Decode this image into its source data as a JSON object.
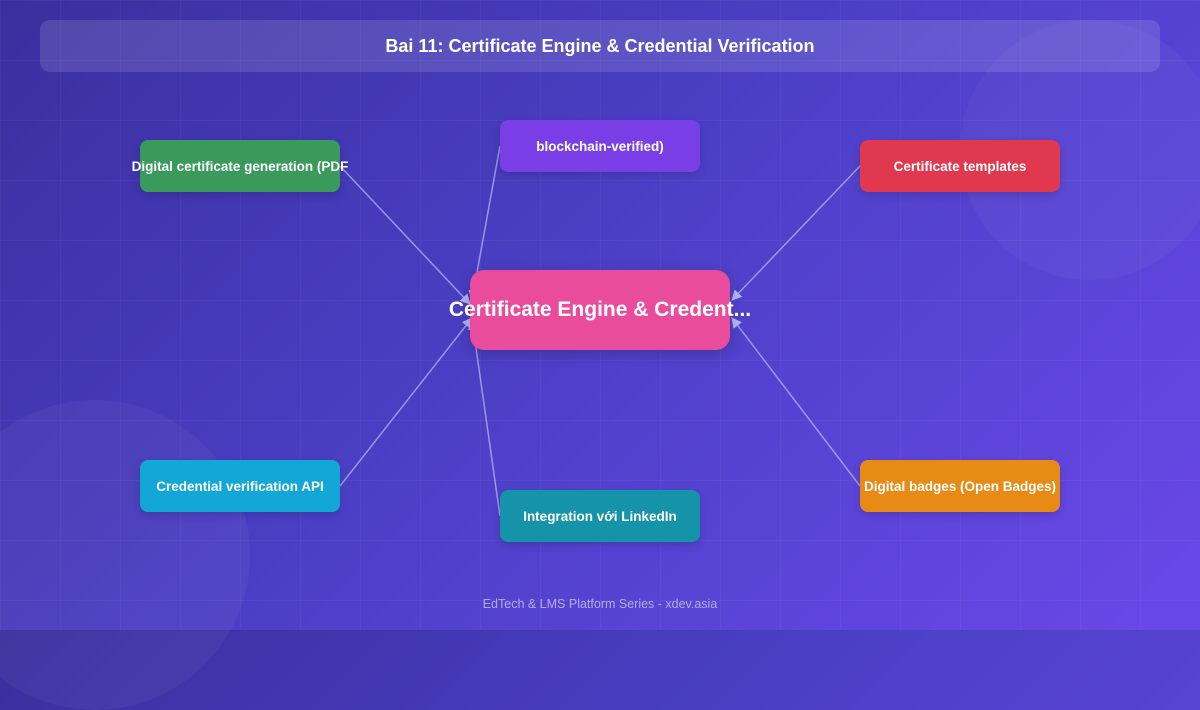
{
  "title": "Bai 11: Certificate Engine & Credential Verification",
  "center": {
    "label": "Certificate Engine & Credent..."
  },
  "nodes": [
    {
      "id": "n1",
      "label": "Digital certificate generation (PDF",
      "color": "#3a9a5b"
    },
    {
      "id": "n2",
      "label": "blockchain-verified)",
      "color": "#7a3ee6"
    },
    {
      "id": "n3",
      "label": "Certificate templates",
      "color": "#e0394f"
    },
    {
      "id": "n4",
      "label": "Credential verification API",
      "color": "#12a7d6"
    },
    {
      "id": "n5",
      "label": "Integration với LinkedIn",
      "color": "#1593a8"
    },
    {
      "id": "n6",
      "label": "Digital badges (Open Badges)",
      "color": "#e88a16"
    }
  ],
  "footer": "EdTech & LMS Platform Series - xdev.asia",
  "colors": {
    "center": "#e84c9b",
    "edge": "#b3b6f0"
  }
}
